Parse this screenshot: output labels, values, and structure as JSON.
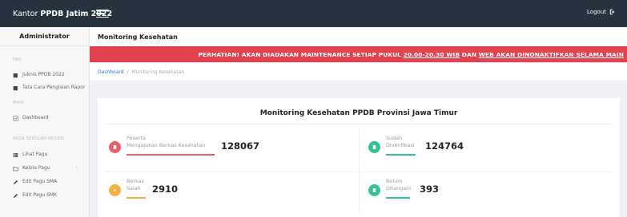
{
  "topbar": {
    "brand_prefix": "Kantor ",
    "brand_bold": "PPDB Jatim 2022",
    "logout_label": "Logout"
  },
  "sidebar": {
    "header": "Administrator",
    "section_info": "FAQ",
    "items_info": [
      {
        "label": "Juknis PPDB 2022",
        "icon": "book-icon"
      },
      {
        "label": "Tata Cara Pengisian Rapor",
        "icon": "book-icon"
      }
    ],
    "section_main": "MAIN",
    "items_main": [
      {
        "label": "Dashboard",
        "icon": "dashboard-icon"
      }
    ],
    "section_sekolah": "PAGU SEKOLAH NEGERI",
    "items_sekolah": [
      {
        "label": "Lihat Pagu",
        "icon": "table-icon"
      },
      {
        "label": "Kelola Pagu",
        "icon": "folder-icon",
        "chevron": "›"
      },
      {
        "label": "Edit Pagu SMA",
        "icon": "pencil-icon"
      },
      {
        "label": "Edit Pagu SMK",
        "icon": "pencil-icon"
      }
    ]
  },
  "main": {
    "page_title": "Monitoring Kesehatan",
    "alert": {
      "prefix": "PERHATIAN! AKAN DIADAKAN MAINTENANCE SETIAP PUKUL ",
      "time": "20.00-20.30 WIB",
      "mid": " DAN ",
      "web": "WEB AKAN DINONAKTIFKAN SELAMA MAIN"
    },
    "breadcrumb": {
      "link": "Dashboard",
      "separator": "/",
      "current": "Monitoring Kesehatan"
    },
    "card_title": "Monitoring Kesehatan PPDB Provinsi Jawa Timur",
    "stats": [
      {
        "label_line1": "Peserta",
        "label_line2": "Mengajukan Berkas Kesehatan",
        "value": "128067",
        "color": "#f25c6a",
        "line_color": "#f25c6a"
      },
      {
        "label_line1": "Sudah",
        "label_line2": "Diverifikasi",
        "value": "124764",
        "color": "#34c38f",
        "line_color": "#34c38f"
      },
      {
        "label_line1": "Berkas",
        "label_line2": "Salah",
        "value": "2910",
        "color": "#f5b041",
        "line_color": "#f5b041"
      },
      {
        "label_line1": "Belum",
        "label_line2": "Ditangani",
        "value": "393",
        "color": "#34c38f",
        "line_color": "#34c38f"
      }
    ]
  },
  "colors": {
    "topbar_bg": "#26323d",
    "alert_bg": "#e2424f",
    "link": "#3a6fd8"
  }
}
